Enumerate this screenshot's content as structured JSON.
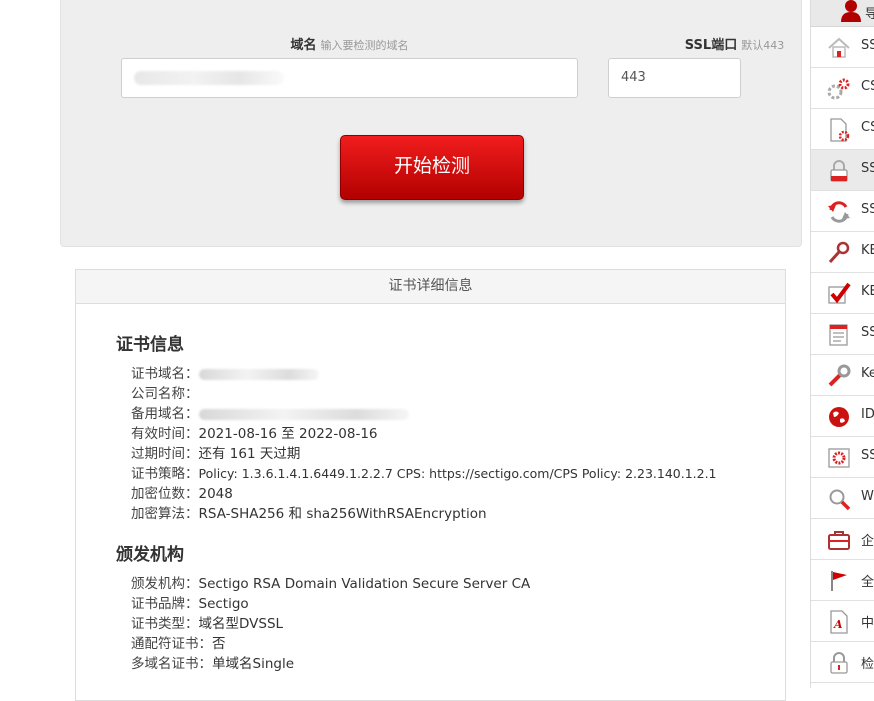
{
  "form": {
    "domain_label": "域名",
    "domain_hint": "输入要检测的域名",
    "domain_value": "",
    "port_label": "SSL端口",
    "port_hint": "默认443",
    "port_value": "443",
    "submit_label": "开始检测"
  },
  "panel": {
    "title": "证书详细信息",
    "cert_section_title": "证书信息",
    "cert_rows": [
      {
        "key": "证书域名：",
        "value": ""
      },
      {
        "key": "公司名称：",
        "value": ""
      },
      {
        "key": "备用域名：",
        "value": ""
      },
      {
        "key": "有效时间：",
        "value": "2021-08-16 至 2022-08-16"
      },
      {
        "key": "过期时间：",
        "value": "还有 161 天过期"
      },
      {
        "key": "证书策略：",
        "value": "Policy: 1.3.6.1.4.1.6449.1.2.2.7 CPS: https://sectigo.com/CPS Policy: 2.23.140.1.2.1"
      },
      {
        "key": "加密位数：",
        "value": "2048"
      },
      {
        "key": "加密算法：",
        "value": "RSA-SHA256 和 sha256WithRSAEncryption"
      }
    ],
    "issuer_section_title": "颁发机构",
    "issuer_rows": [
      {
        "key": "颁发机构：",
        "value": "Sectigo RSA Domain Validation Secure Server CA"
      },
      {
        "key": "证书品牌：",
        "value": "Sectigo"
      },
      {
        "key": "证书类型：",
        "value": "域名型DVSSL"
      },
      {
        "key": "通配符证书：",
        "value": "否"
      },
      {
        "key": "多域名证书：",
        "value": "单域名Single"
      }
    ]
  },
  "sidebar": {
    "header_label": "导",
    "items": [
      {
        "label": "SS",
        "icon": "home-icon"
      },
      {
        "label": "CS",
        "icon": "gears-icon"
      },
      {
        "label": "CS",
        "icon": "document-gear-icon"
      },
      {
        "label": "SS",
        "icon": "lock-icon"
      },
      {
        "label": "SS",
        "icon": "convert-arrows-icon"
      },
      {
        "label": "KE",
        "icon": "key-icon"
      },
      {
        "label": "KE",
        "icon": "checkmark-icon"
      },
      {
        "label": "SS",
        "icon": "certificate-list-icon"
      },
      {
        "label": "Ke",
        "icon": "wrench-icon"
      },
      {
        "label": "ID",
        "icon": "globe-icon"
      },
      {
        "label": "SS",
        "icon": "seal-icon"
      },
      {
        "label": "W",
        "icon": "magnifier-icon"
      },
      {
        "label": "企",
        "icon": "briefcase-icon"
      },
      {
        "label": "全",
        "icon": "flag-icon"
      },
      {
        "label": "中",
        "icon": "font-doc-icon"
      },
      {
        "label": "检",
        "icon": "padlock-icon"
      }
    ]
  },
  "colors": {
    "button_red": "#d10000",
    "panel_grey": "#eeeeee",
    "icon_red": "#cc1111"
  }
}
